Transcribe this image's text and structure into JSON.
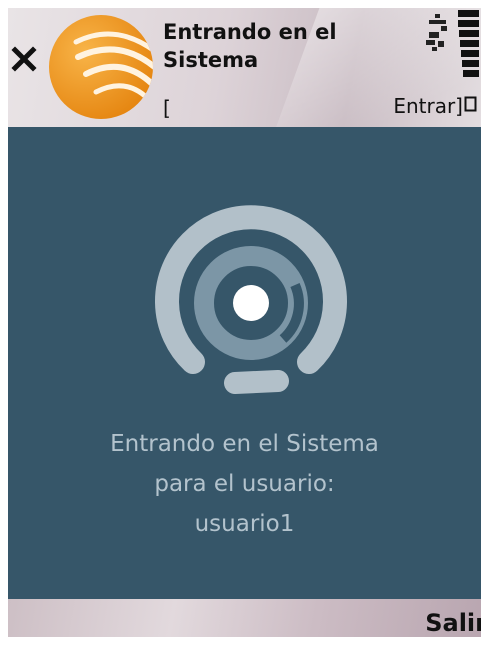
{
  "header": {
    "title_line1": "Entrando en el",
    "title_line2": "Sistema",
    "bracket_open": "[",
    "progress_text": "Entrar]"
  },
  "main": {
    "message_line1": "Entrando en el Sistema",
    "message_line2": "para el usuario:",
    "message_line3": "usuario1"
  },
  "softkeys": {
    "right": "Salir"
  },
  "icons": {
    "close": "close-icon",
    "logo": "app-logo",
    "signal": "signal-icon",
    "battery": "battery-icon",
    "spinner": "loading-spinner-icon"
  },
  "colors": {
    "main_background": "#365669",
    "message_text": "#b3c3cd",
    "logo_orange": "#f0920e"
  }
}
